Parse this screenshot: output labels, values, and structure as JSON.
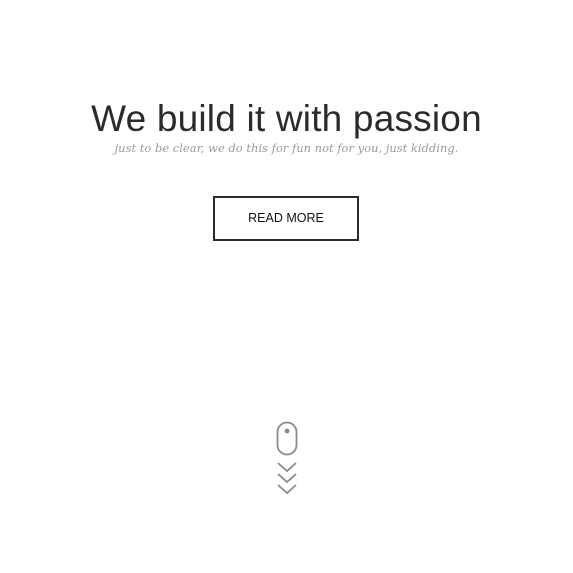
{
  "hero": {
    "title": "We build it with passion",
    "subtitle": "just to be clear, we do this for fun not for you, just kidding."
  },
  "cta": {
    "label": "READ MORE"
  },
  "scroll_indicator": {
    "icons": [
      "mouse-icon",
      "chevron-down-icon",
      "chevron-down-icon",
      "chevron-down-icon"
    ]
  },
  "colors": {
    "background": "#ffffff",
    "text": "#2b2b2b",
    "subtitle": "#9a9a9a",
    "icon": "#8a8a8a"
  }
}
